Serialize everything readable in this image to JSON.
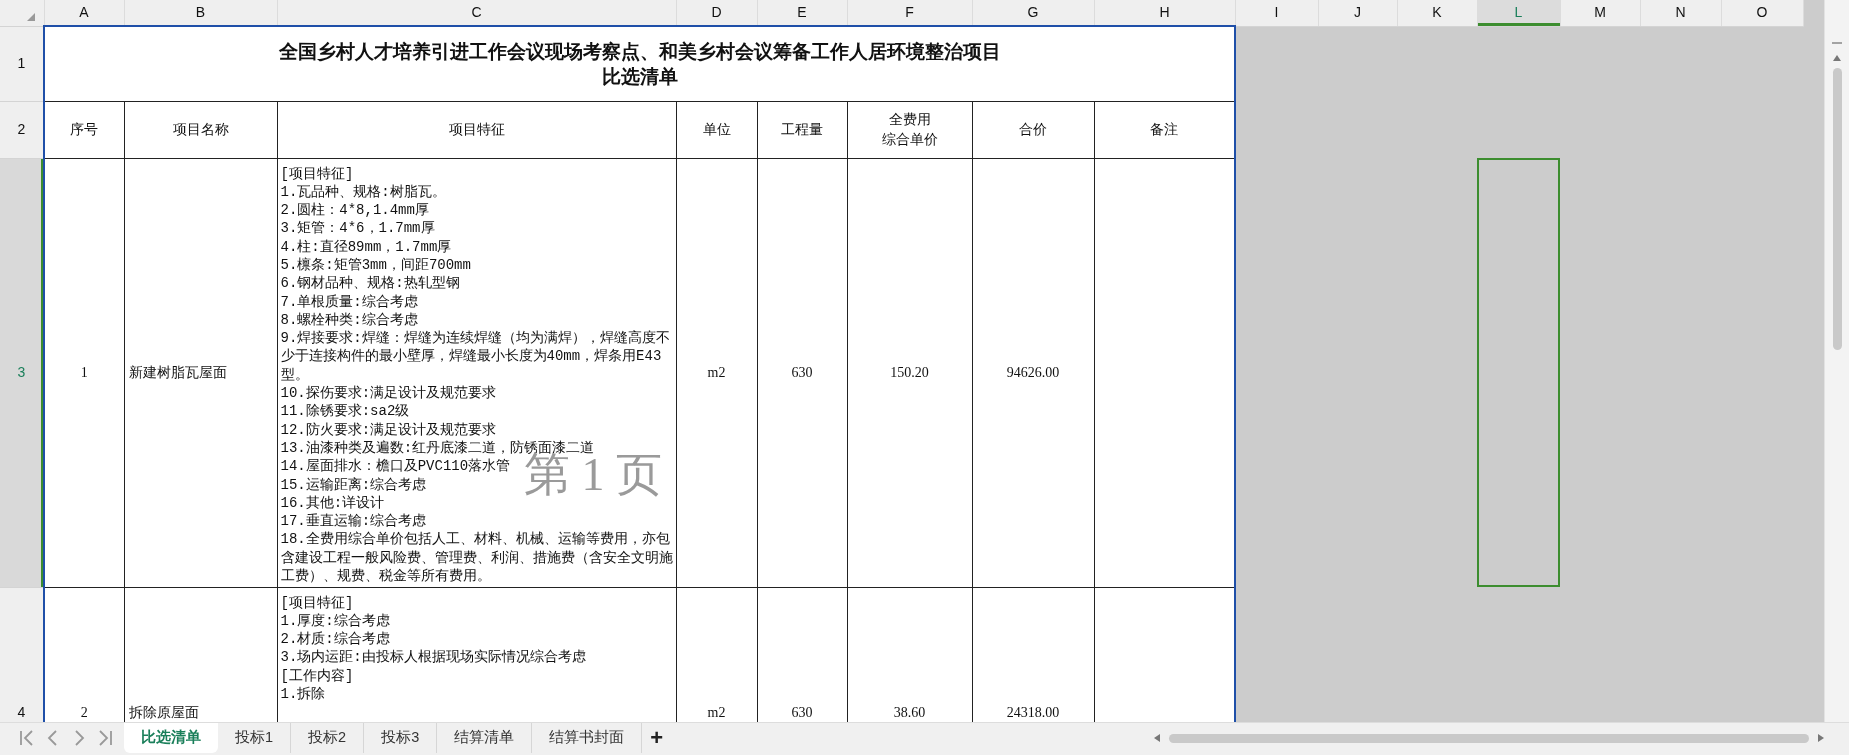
{
  "columns": [
    {
      "label": "A",
      "selected": false
    },
    {
      "label": "B",
      "selected": false
    },
    {
      "label": "C",
      "selected": false
    },
    {
      "label": "D",
      "selected": false
    },
    {
      "label": "E",
      "selected": false
    },
    {
      "label": "F",
      "selected": false
    },
    {
      "label": "G",
      "selected": false
    },
    {
      "label": "H",
      "selected": false
    },
    {
      "label": "I",
      "selected": false
    },
    {
      "label": "J",
      "selected": false
    },
    {
      "label": "K",
      "selected": false
    },
    {
      "label": "L",
      "selected": true
    },
    {
      "label": "M",
      "selected": false
    },
    {
      "label": "N",
      "selected": false
    },
    {
      "label": "O",
      "selected": false
    }
  ],
  "rows": [
    {
      "label": "1",
      "selected": false
    },
    {
      "label": "2",
      "selected": false
    },
    {
      "label": "3",
      "selected": true
    },
    {
      "label": "4",
      "selected": false
    }
  ],
  "title": [
    "全国乡村人才培养引进工作会议现场考察点、和美乡村会议筹备工作人居环境整治项目",
    "比选清单"
  ],
  "headers": [
    [
      "序号"
    ],
    [
      "项目名称"
    ],
    [
      "项目特征"
    ],
    [
      "单位"
    ],
    [
      "工程量"
    ],
    [
      "全费用",
      "综合单价"
    ],
    [
      "合价"
    ],
    [
      "备注"
    ]
  ],
  "items": [
    {
      "no": "1",
      "name": "新建树脂瓦屋面",
      "features": [
        "[项目特征]",
        "1.瓦品种、规格:树脂瓦。",
        "2.圆柱：4*8,1.4mm厚",
        "3.矩管：4*6，1.7mm厚",
        "4.柱:直径89mm，1.7mm厚",
        "5.檩条:矩管3mm，间距700mm",
        "6.钢材品种、规格:热轧型钢",
        "7.单根质量:综合考虑",
        "8.螺栓种类:综合考虑",
        "9.焊接要求:焊缝：焊缝为连续焊缝（均为满焊），焊缝高度不少于连接构件的最小壁厚，焊缝最小长度为40mm，焊条用E43型。",
        "10.探伤要求:满足设计及规范要求",
        "11.除锈要求:sa2级",
        "12.防火要求:满足设计及规范要求",
        "13.油漆种类及遍数:红丹底漆二道，防锈面漆二道",
        "14.屋面排水：檐口及PVC110落水管",
        "15.运输距离:综合考虑",
        "16.其他:详设计",
        "17.垂直运输:综合考虑",
        "18.全费用综合单价包括人工、材料、机械、运输等费用，亦包含建设工程一般风险费、管理费、利润、措施费（含安全文明施工费）、规费、税金等所有费用。"
      ],
      "unit": "m2",
      "quantity": "630",
      "unit_price": "150.20",
      "total": "94626.00"
    },
    {
      "no": "2",
      "name": "拆除原屋面",
      "features": [
        "[项目特征]",
        "1.厚度:综合考虑",
        "2.材质:综合考虑",
        "3.场内运距:由投标人根据现场实际情况综合考虑",
        "[工作内容]",
        "1.拆除"
      ],
      "unit": "m2",
      "quantity": "630",
      "unit_price": "38.60",
      "total": "24318.00"
    }
  ],
  "page_label": "第 1 页",
  "sheet_tabs": [
    {
      "label": "比选清单",
      "selected": true
    },
    {
      "label": "投标1",
      "selected": false
    },
    {
      "label": "投标2",
      "selected": false
    },
    {
      "label": "投标3",
      "selected": false
    },
    {
      "label": "结算清单",
      "selected": false
    },
    {
      "label": "结算书封面",
      "selected": false
    }
  ],
  "add_sheet": "+"
}
